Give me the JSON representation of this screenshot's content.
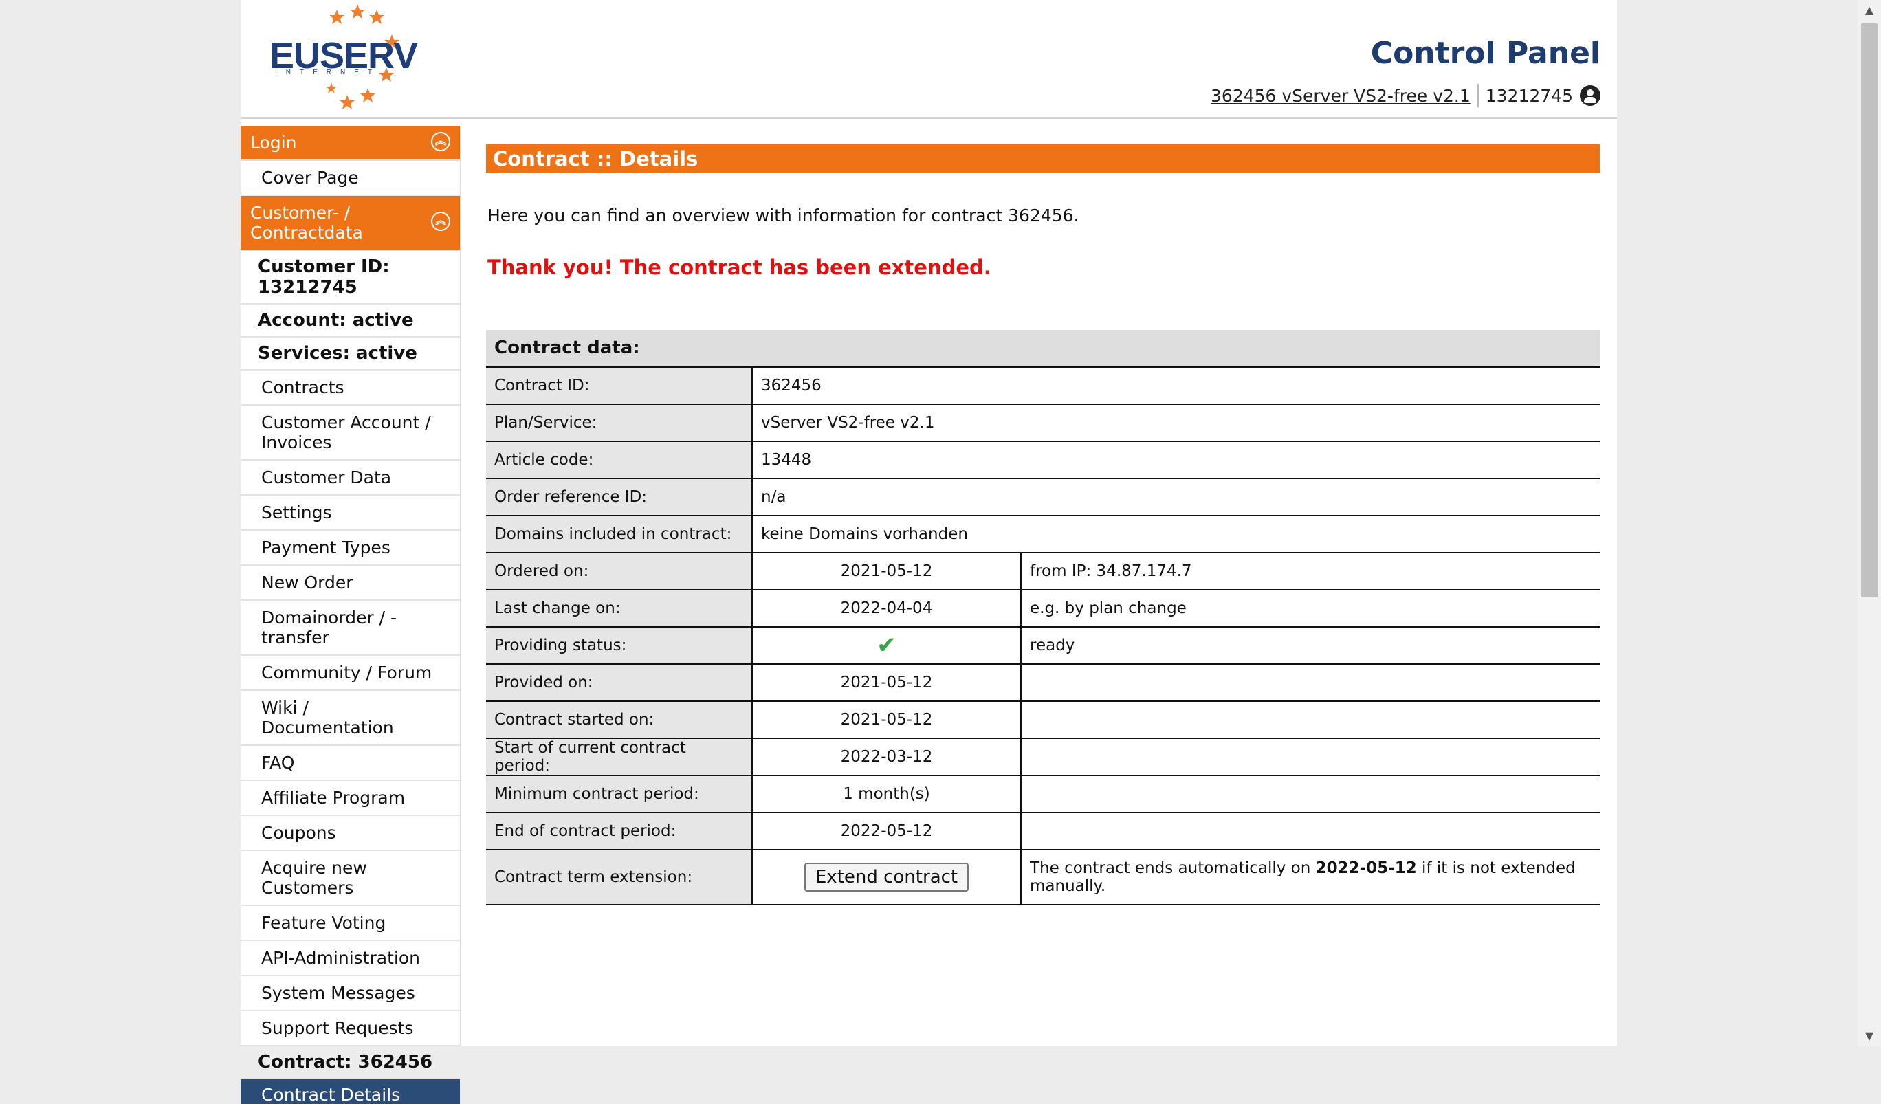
{
  "header": {
    "logo_text": "EUSERV",
    "logo_sub": "INTERNET",
    "title": "Control Panel",
    "contract_link": "362456 vServer VS2-free v2.1",
    "customer_id": "13212745"
  },
  "sidebar": {
    "login_head": "Login",
    "cover_page": "Cover Page",
    "customer_head": "Customer- / Contractdata",
    "customer_id": "Customer ID: 13212745",
    "account": "Account: active",
    "services": "Services: active",
    "items": [
      "Contracts",
      "Customer Account / Invoices",
      "Customer Data",
      "Settings",
      "Payment Types",
      "New Order",
      "Domainorder / -transfer",
      "Community / Forum",
      "Wiki / Documentation",
      "FAQ",
      "Affiliate Program",
      "Coupons",
      "Acquire new Customers",
      "Feature Voting",
      "API-Administration",
      "System Messages",
      "Support Requests"
    ],
    "contract": "Contract: 362456",
    "active_item": "Contract Details"
  },
  "main": {
    "title": "Contract :: Details",
    "intro": "Here you can find an overview with information for contract 362456.",
    "thanks": "Thank you! The contract has been extended.",
    "table_head": "Contract data:",
    "rows": {
      "contract_id": {
        "label": "Contract ID:",
        "value": "362456"
      },
      "plan": {
        "label": "Plan/Service:",
        "value": "vServer VS2-free v2.1"
      },
      "article": {
        "label": "Article code:",
        "value": "13448"
      },
      "order_ref": {
        "label": "Order reference ID:",
        "value": "n/a"
      },
      "domains": {
        "label": "Domains included in contract:",
        "value": "keine Domains vorhanden"
      },
      "ordered": {
        "label": "Ordered on:",
        "value": "2021-05-12",
        "note": "from IP: 34.87.174.7"
      },
      "last_change": {
        "label": "Last change on:",
        "value": "2022-04-04",
        "note": "e.g. by plan change"
      },
      "providing": {
        "label": "Providing status:",
        "value": "✔",
        "note": "ready"
      },
      "provided": {
        "label": "Provided on:",
        "value": "2021-05-12"
      },
      "started": {
        "label": "Contract started on:",
        "value": "2021-05-12"
      },
      "period_start": {
        "label": "Start of current contract period:",
        "value": "2022-03-12"
      },
      "min_period": {
        "label": "Minimum contract period:",
        "value": "1 month(s)"
      },
      "period_end": {
        "label": "End of contract period:",
        "value": "2022-05-12"
      },
      "extension": {
        "label": "Contract term extension:",
        "button": "Extend contract",
        "note_pre": "The contract ends automatically on ",
        "note_date": "2022-05-12",
        "note_post": " if it is not extended manually."
      }
    }
  }
}
